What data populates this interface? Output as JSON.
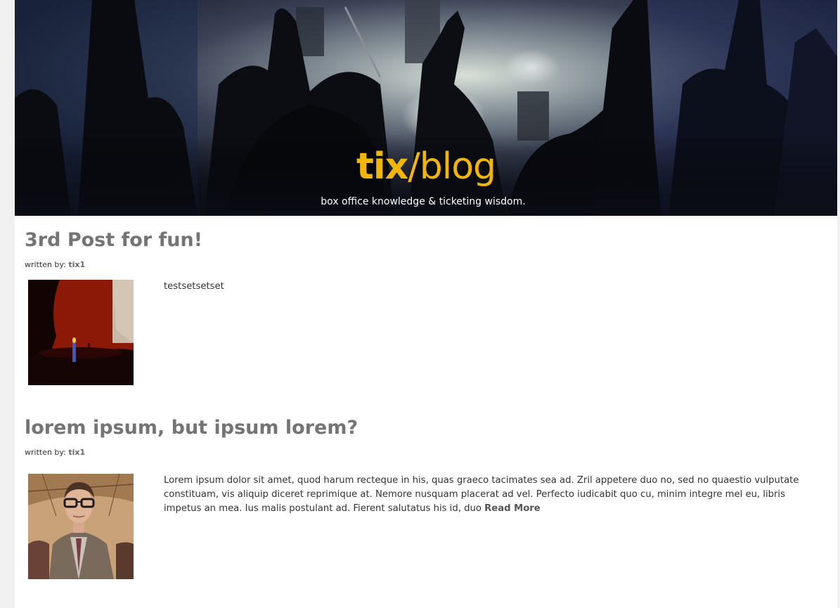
{
  "header": {
    "title_main": "tix",
    "title_rest": "/blog",
    "subtitle": "box office knowledge & ticketing wisdom."
  },
  "posts": [
    {
      "title": "3rd Post for fun!",
      "byline_prefix": "written by: ",
      "author": "tix1",
      "body": "testsetsetset",
      "read_more": ""
    },
    {
      "title": "lorem ipsum, but ipsum lorem?",
      "byline_prefix": "written by: ",
      "author": "tix1",
      "body": "Lorem ipsum dolor sit amet, quod harum recteque in his, quas graeco tacimates sea ad. Zril appetere duo no, sed no quaestio vulputate constituam, vis aliquip diceret reprimique at. Nemore nusquam placerat ad vel. Perfecto iudicabit quo cu, minim integre mel eu, libris impetus an mea. Ius malis postulant ad. Fierent salutatus his id, duo ",
      "read_more": "Read More"
    }
  ],
  "colors": {
    "brand_accent": "#f2b705",
    "heading": "#747474",
    "body_text": "#333333",
    "hero_bg": "#1a1d2a"
  }
}
